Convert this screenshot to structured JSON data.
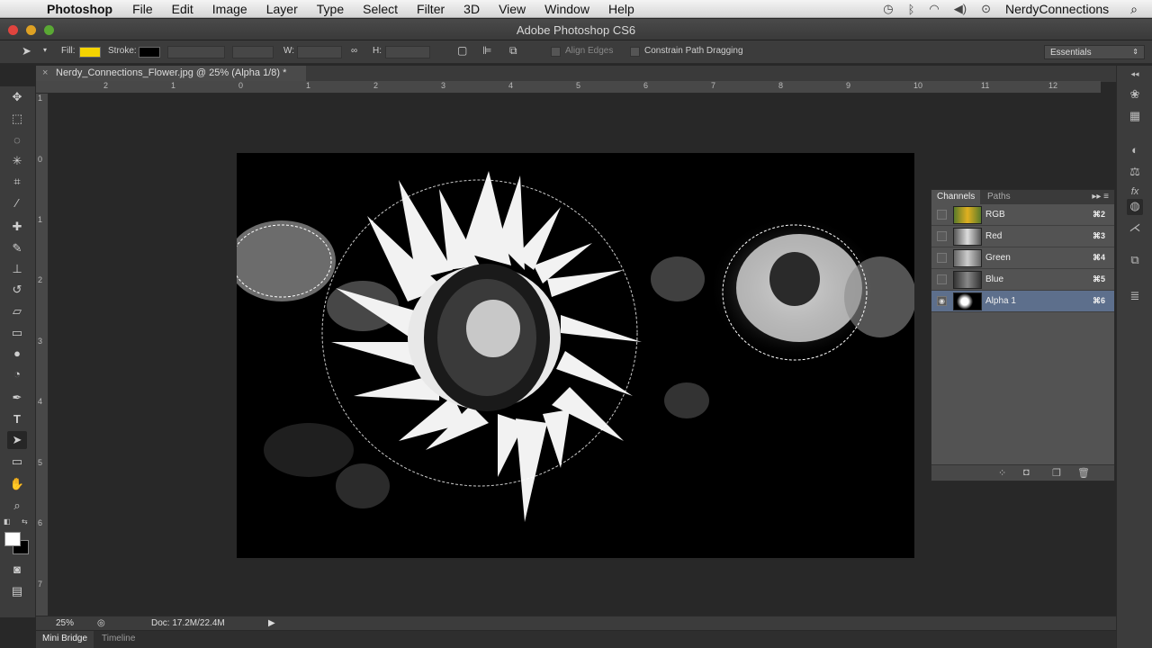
{
  "menubar": {
    "app": "Photoshop",
    "items": [
      "File",
      "Edit",
      "Image",
      "Layer",
      "Type",
      "Select",
      "Filter",
      "3D",
      "View",
      "Window",
      "Help"
    ],
    "user": "NerdyConnections"
  },
  "window": {
    "title": "Adobe Photoshop CS6"
  },
  "options": {
    "fill_label": "Fill:",
    "stroke_label": "Stroke:",
    "w_label": "W:",
    "h_label": "H:",
    "align_edges": "Align Edges",
    "constrain": "Constrain Path Dragging",
    "workspace": "Essentials",
    "fill_color": "#f5d400",
    "stroke_color": "#000000"
  },
  "document": {
    "tab_label": "Nerdy_Connections_Flower.jpg @ 25% (Alpha 1/8) *"
  },
  "ruler": {
    "h_ticks": [
      "2",
      "1",
      "0",
      "1",
      "2",
      "3",
      "4",
      "5",
      "6",
      "7",
      "8",
      "9",
      "10",
      "11",
      "12"
    ],
    "v_ticks": [
      "1",
      "0",
      "1",
      "2",
      "3",
      "4",
      "5",
      "6",
      "7"
    ]
  },
  "channels": {
    "tabs": [
      "Channels",
      "Paths"
    ],
    "rows": [
      {
        "name": "RGB",
        "key": "⌘2"
      },
      {
        "name": "Red",
        "key": "⌘3"
      },
      {
        "name": "Green",
        "key": "⌘4"
      },
      {
        "name": "Blue",
        "key": "⌘5"
      },
      {
        "name": "Alpha 1",
        "key": "⌘6"
      }
    ]
  },
  "status": {
    "zoom": "25%",
    "doc": "Doc: 17.2M/22.4M"
  },
  "bottom_tabs": [
    "Mini Bridge",
    "Timeline"
  ]
}
